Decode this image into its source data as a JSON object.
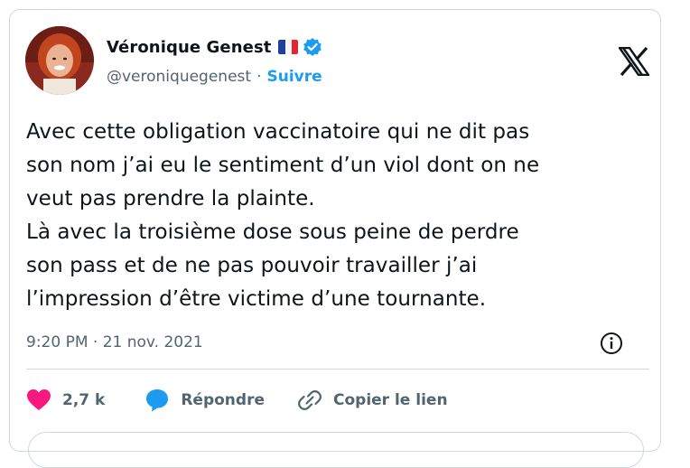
{
  "author": {
    "display_name": "Véronique Genest",
    "handle": "@veroniquegenest",
    "separator": "·",
    "follow_label": "Suivre",
    "flag": "french-flag-icon",
    "verified": "verified-badge-icon"
  },
  "tweet": {
    "lines": [
      "Avec cette obligation vaccinatoire qui ne dit pas",
      "son nom j’ai eu le sentiment d’un viol dont on ne",
      "veut pas prendre la plainte.",
      "Là avec la troisième dose sous peine de perdre",
      "son pass et de ne pas pouvoir travailler j’ai",
      "l’impression d’être victime d’une tournante."
    ],
    "timestamp": "9:20 PM · 21 nov. 2021"
  },
  "actions": {
    "like_count": "2,7 k",
    "reply_label": "Répondre",
    "copy_link_label": "Copier le lien"
  },
  "colors": {
    "accent": "#1d9bf0",
    "like": "#f91880",
    "text": "#0f1419",
    "muted": "#536471",
    "border": "#cfd9de"
  }
}
